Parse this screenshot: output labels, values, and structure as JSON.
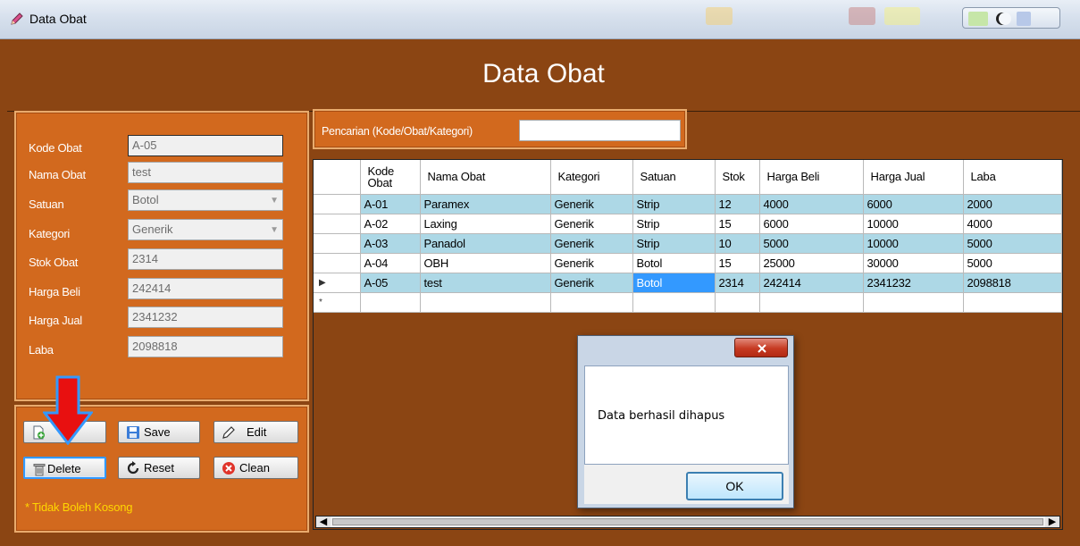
{
  "window": {
    "title": "Data Obat"
  },
  "form": {
    "title": "Data Obat"
  },
  "inputs": {
    "kode": {
      "label": "Kode Obat",
      "value": "A-05"
    },
    "nama": {
      "label": "Nama Obat",
      "value": "test"
    },
    "satuan": {
      "label": "Satuan",
      "value": "Botol"
    },
    "kategori": {
      "label": "Kategori",
      "value": "Generik"
    },
    "stok": {
      "label": "Stok Obat",
      "value": "2314"
    },
    "beli": {
      "label": "Harga Beli",
      "value": "242414"
    },
    "jual": {
      "label": "Harga Jual",
      "value": "2341232"
    },
    "laba": {
      "label": "Laba",
      "value": "2098818"
    }
  },
  "buttons": {
    "save": "Save",
    "edit": "Edit",
    "delete": "Delete",
    "reset": "Reset",
    "clean": "Clean"
  },
  "note": "* Tidak Boleh Kosong",
  "search": {
    "label": "Pencarian (Kode/Obat/Kategori)",
    "value": ""
  },
  "grid": {
    "columns": [
      "Kode Obat",
      "Nama Obat",
      "Kategori",
      "Satuan",
      "Stok",
      "Harga Beli",
      "Harga Jual",
      "Laba"
    ],
    "rows": [
      [
        "A-01",
        "Paramex",
        "Generik",
        "Strip",
        "12",
        "4000",
        "6000",
        "2000"
      ],
      [
        "A-02",
        "Laxing",
        "Generik",
        "Strip",
        "15",
        "6000",
        "10000",
        "4000"
      ],
      [
        "A-03",
        "Panadol",
        "Generik",
        "Strip",
        "10",
        "5000",
        "10000",
        "5000"
      ],
      [
        "A-04",
        "OBH",
        "Generik",
        "Botol",
        "15",
        "25000",
        "30000",
        "5000"
      ],
      [
        "A-05",
        "test",
        "Generik",
        "Botol",
        "2314",
        "242414",
        "2341232",
        "2098818"
      ]
    ],
    "current_row_marker": "▶",
    "new_row_marker": "*"
  },
  "messagebox": {
    "text": "Data berhasil dihapus",
    "ok": "OK"
  },
  "colors": {
    "form_bg": "#8b4513",
    "panel_bg": "#d2691e",
    "alt_row": "#add8e6",
    "selection": "#3399ff",
    "note": "#ffd700"
  }
}
